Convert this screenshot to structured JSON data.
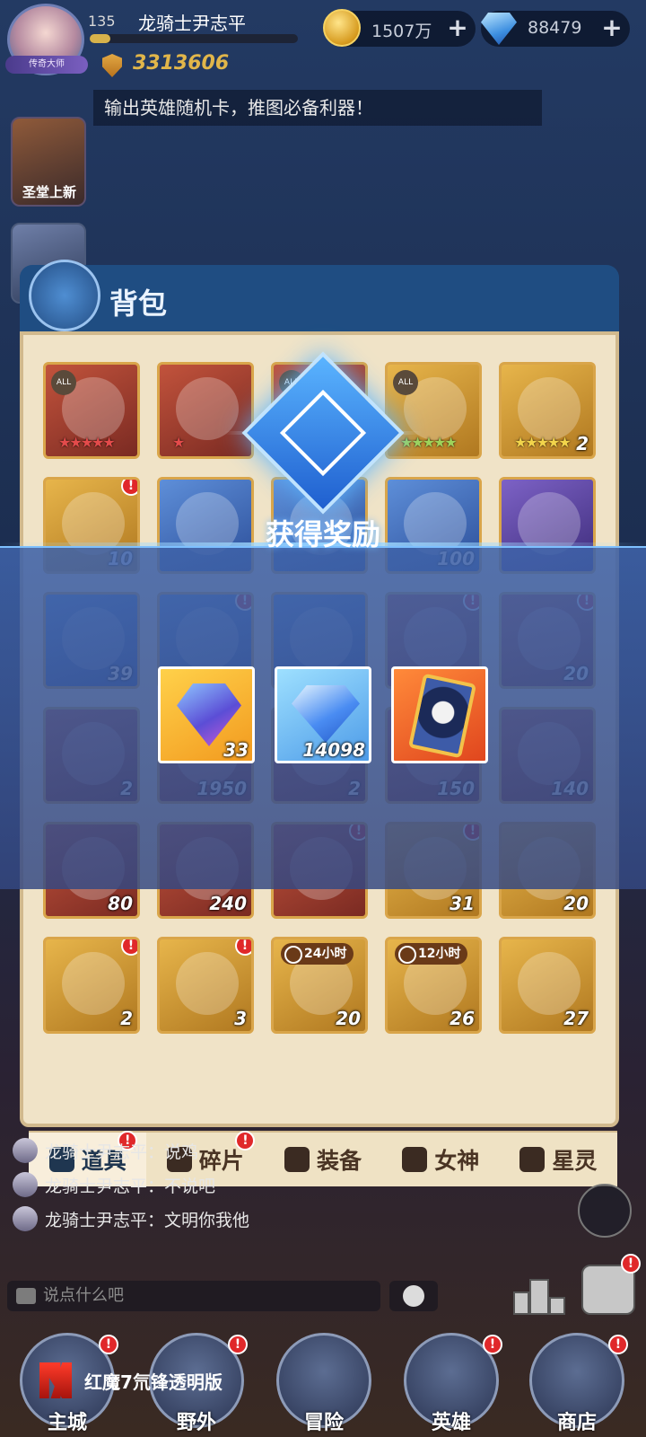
{
  "header": {
    "level": "135",
    "player_name": "龙骑士尹志平",
    "avatar_badge": "传奇大师",
    "xp_progress_percent": 10,
    "power": "3313606",
    "gold": "1507万",
    "diamonds": "88479",
    "add_label": "+"
  },
  "marquee": "输出英雄随机卡，推图必备利器！",
  "side_event": {
    "label": "圣堂上新"
  },
  "bag": {
    "title": "背包",
    "rows": [
      [
        {
          "color": "red",
          "tag": "ALL",
          "stars": "★★★★★",
          "star_color": "red"
        },
        {
          "color": "red",
          "stars": "★",
          "star_color": "red"
        },
        {
          "color": "red",
          "tag": "ALL"
        },
        {
          "color": "gold",
          "tag": "ALL",
          "stars": "★★★★★",
          "star_color": "green"
        },
        {
          "color": "gold",
          "stars": "★★★★★",
          "star_color": "yellow",
          "count": "2"
        }
      ],
      [
        {
          "color": "gold",
          "count": "10",
          "alert": true
        },
        {
          "color": "blue"
        },
        {
          "color": "blue"
        },
        {
          "color": "blue",
          "count": "100"
        },
        {
          "color": "purple"
        }
      ],
      [
        {
          "color": "blue",
          "count": "39"
        },
        {
          "color": "blue",
          "alert": true
        },
        {
          "color": "blue"
        },
        {
          "color": "red",
          "alert": true
        },
        {
          "color": "red",
          "count": "20",
          "alert": true
        }
      ],
      [
        {
          "color": "red",
          "count": "2"
        },
        {
          "color": "red",
          "count": "1950"
        },
        {
          "color": "red",
          "count": "2"
        },
        {
          "color": "red",
          "count": "150"
        },
        {
          "color": "red",
          "count": "140"
        }
      ],
      [
        {
          "color": "red",
          "count": "80"
        },
        {
          "color": "red",
          "count": "240"
        },
        {
          "color": "red",
          "alert": true
        },
        {
          "color": "gold",
          "count": "31",
          "alert": true
        },
        {
          "color": "gold",
          "count": "20"
        }
      ],
      [
        {
          "color": "gold",
          "count": "2",
          "alert": true
        },
        {
          "color": "gold",
          "count": "3",
          "alert": true
        },
        {
          "color": "gold",
          "count": "20",
          "timer": "24小时"
        },
        {
          "color": "gold",
          "count": "26",
          "timer": "12小时"
        },
        {
          "color": "gold",
          "count": "27"
        }
      ]
    ],
    "tabs": [
      {
        "label": "道具",
        "icon": "item-icon",
        "active": true,
        "alert": true
      },
      {
        "label": "碎片",
        "icon": "fragment-icon",
        "active": false,
        "alert": true
      },
      {
        "label": "装备",
        "icon": "equipment-icon",
        "active": false,
        "alert": false
      },
      {
        "label": "女神",
        "icon": "goddess-icon",
        "active": false,
        "alert": false
      },
      {
        "label": "星灵",
        "icon": "star-spirit-icon",
        "active": false,
        "alert": false
      }
    ]
  },
  "chat": {
    "messages": [
      {
        "text": "龙骑士尹志平：说鸡"
      },
      {
        "text": "龙骑士尹志平：不说吧"
      },
      {
        "text": "龙骑士尹志平：文明你我他"
      }
    ],
    "input_placeholder": "说点什么吧"
  },
  "reward": {
    "title": "获得奖励",
    "items": [
      {
        "icon": "crystal-icon",
        "color": "gold",
        "count": "33"
      },
      {
        "icon": "diamond-icon",
        "color": "blue",
        "count": "14098"
      },
      {
        "icon": "hero-card-icon",
        "color": "orange",
        "count": ""
      }
    ]
  },
  "nav": {
    "items": [
      {
        "label": "主城",
        "alert": true
      },
      {
        "label": "野外",
        "alert": true
      },
      {
        "label": "冒险",
        "alert": false
      },
      {
        "label": "英雄",
        "alert": true
      },
      {
        "label": "商店",
        "alert": true
      }
    ]
  },
  "watermark": "红魔7氘锋透明版",
  "alert_mark": "!",
  "colors": {
    "accent_blue": "#1f4d82",
    "alert_red": "#e0282a",
    "power_gold": "#e1b64a",
    "panel_bg": "#f0e3c7"
  }
}
